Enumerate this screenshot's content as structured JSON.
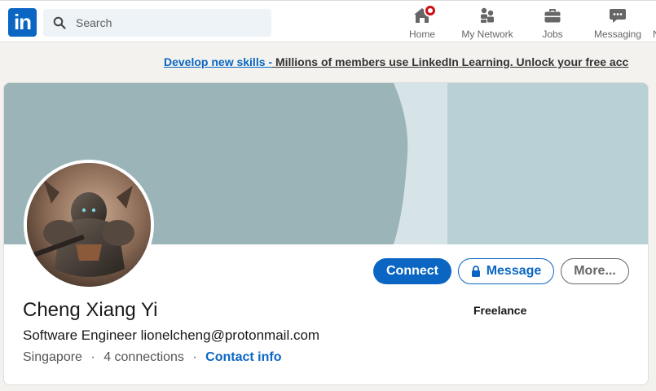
{
  "header": {
    "logo_text": "in",
    "search_placeholder": "Search",
    "nav": [
      {
        "label": "Home",
        "icon": "home-icon",
        "has_badge": true
      },
      {
        "label": "My Network",
        "icon": "network-icon"
      },
      {
        "label": "Jobs",
        "icon": "briefcase-icon"
      },
      {
        "label": "Messaging",
        "icon": "messaging-icon"
      },
      {
        "label": "N",
        "icon": "notifications-icon"
      }
    ]
  },
  "promo": {
    "link_text": "Develop new skills -",
    "text": " Millions of members use LinkedIn Learning. Unlock your free acc"
  },
  "profile": {
    "name": "Cheng Xiang Yi",
    "headline": "Software Engineer lionelcheng@protonmail.com",
    "location": "Singapore",
    "separator": "·",
    "connections": "4 connections",
    "contact_info": "Contact info",
    "company": "Freelance",
    "actions": {
      "connect": "Connect",
      "message": "Message",
      "more": "More..."
    }
  },
  "colors": {
    "brand": "#0a66c2",
    "cover_left": "#9bb4b8",
    "cover_mid": "#d7e4e7",
    "cover_right": "#b8d0d6",
    "badge": "#cc1016"
  }
}
